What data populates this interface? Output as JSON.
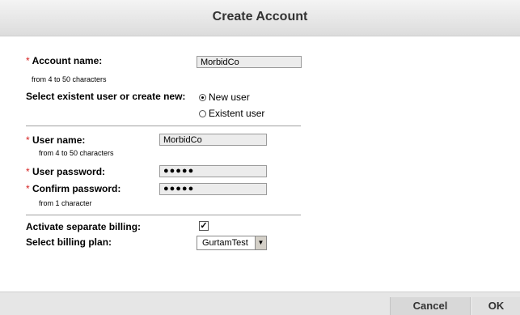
{
  "window": {
    "title": "Create Account"
  },
  "account": {
    "name_label": "Account name:",
    "name_hint": "from 4 to 50 characters",
    "name_value": "MorbidCo"
  },
  "user_choice": {
    "label": "Select existent user or create new:",
    "options": [
      "New user",
      "Existent user"
    ],
    "selected": "New user"
  },
  "user": {
    "name_label": "User name:",
    "name_hint": "from 4 to 50 characters",
    "name_value": "MorbidCo",
    "password_label": "User password:",
    "password_value": "●●●●●",
    "confirm_label": "Confirm password:",
    "confirm_value": "●●●●●",
    "password_hint": "from 1 character"
  },
  "billing": {
    "separate_label": "Activate separate billing:",
    "separate_checked": true,
    "check_glyph": "✓",
    "plan_label": "Select billing plan:",
    "plan_value": "GurtamTest",
    "dropdown_glyph": "▼"
  },
  "required_marker": "*",
  "footer": {
    "cancel": "Cancel",
    "ok": "OK"
  }
}
